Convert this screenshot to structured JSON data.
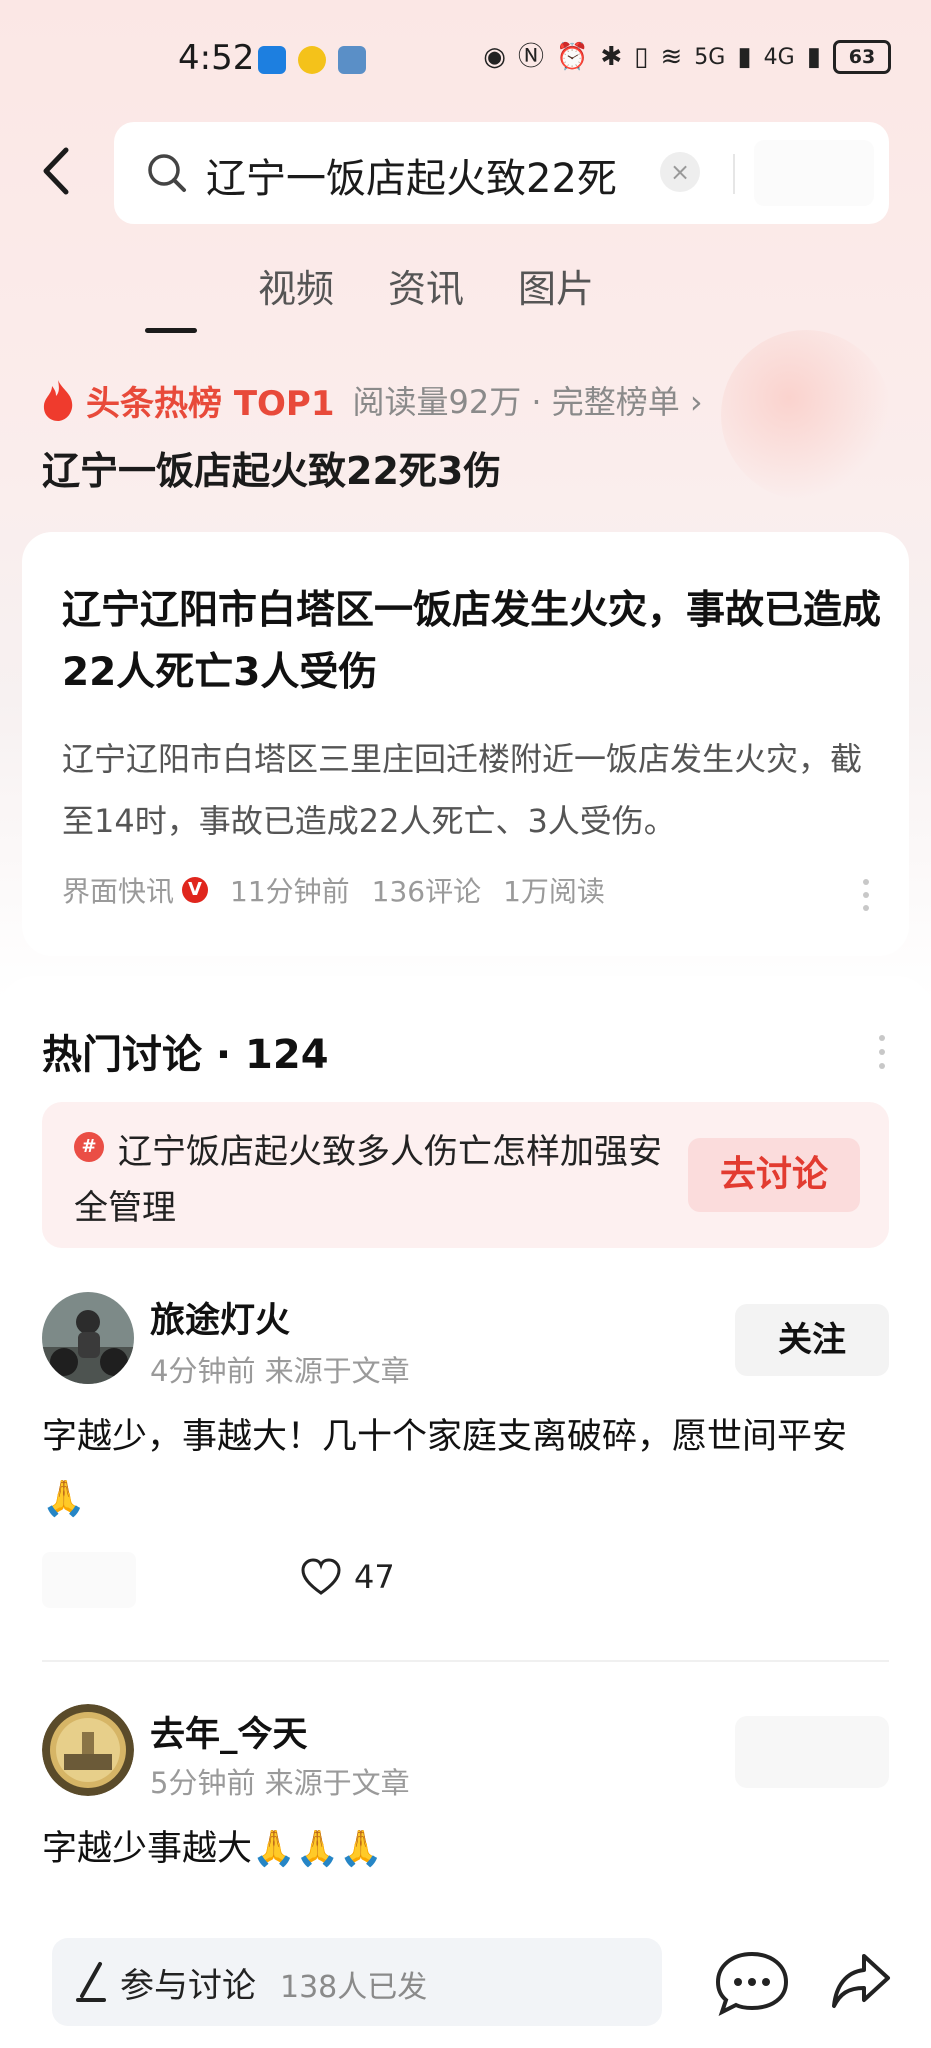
{
  "status_bar": {
    "time": "4:52",
    "notification_icons": [
      "bluetooth-app-icon",
      "weibo-icon",
      "app-icon"
    ],
    "network_5g": "5G",
    "network_4g": "4G",
    "battery": "63"
  },
  "search": {
    "query": "辽宁一饭店起火致22死",
    "clear_glyph": "×"
  },
  "tabs": [
    {
      "label": "视频"
    },
    {
      "label": "资讯"
    },
    {
      "label": "图片"
    }
  ],
  "hot": {
    "label": "头条热榜 TOP1",
    "meta": "阅读量92万 · 完整榜单 ›",
    "title": "辽宁一饭店起火致22死3伤"
  },
  "article": {
    "title": "辽宁辽阳市白塔区一饭店发生火灾，事故已造成22人死亡3人受伤",
    "summary": "辽宁辽阳市白塔区三里庄回迁楼附近一饭店发生火灾，截至14时，事故已造成22人死亡、3人受伤。",
    "source": "界面快讯",
    "verified_glyph": "V",
    "time": "11分钟前",
    "comments": "136评论",
    "reads": "1万阅读"
  },
  "discussion": {
    "title": "热门讨论 · 124",
    "topic_glyph": "#",
    "topic": "辽宁饭店起火致多人伤亡怎样加强安全管理",
    "go_label": "去讨论"
  },
  "comments": [
    {
      "name": "旅途灯火",
      "meta": "4分钟前  来源于文章",
      "text": "字越少，事越大！几十个家庭支离破碎，愿世间平安",
      "emoji": "🙏",
      "follow_label": "关注",
      "likes": "47"
    },
    {
      "name": "去年_今天",
      "meta": "5分钟前  来源于文章",
      "text": "字越少事越大🙏🙏🙏"
    }
  ],
  "bottom_bar": {
    "join_label": "参与讨论",
    "join_count": "138人已发"
  },
  "colors": {
    "accent_red": "#e84a3a",
    "topic_bg": "#fdf0f0",
    "go_button_bg": "#fbdcdc"
  }
}
